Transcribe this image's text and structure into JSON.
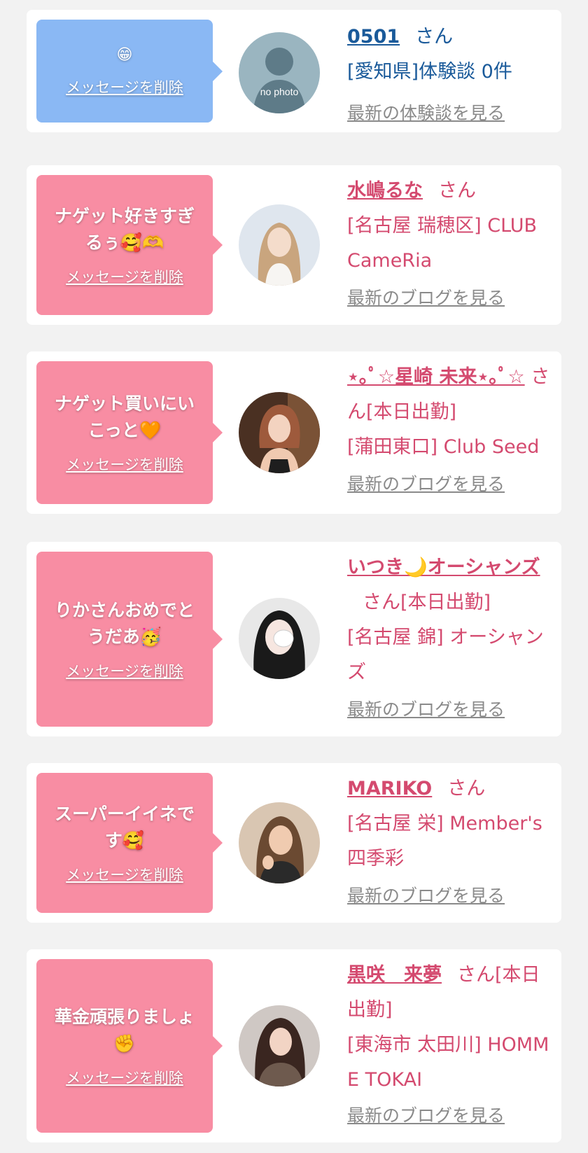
{
  "colors": {
    "page_background": "#f2f2f2",
    "card_background": "#ffffff",
    "bubble_blue": "#8ab8f4",
    "bubble_pink": "#f88da3",
    "text_pink": "#d44a6f",
    "text_blue": "#1a5a9a",
    "link_gray": "#8a8a8a"
  },
  "delete_label": "メッセージを削除",
  "cards": [
    {
      "message": "😁",
      "name": "0501",
      "san": "さん",
      "location": "[愛知県]体験談 0件",
      "view_link": "最新の体験談を見る",
      "avatar_text": "no photo",
      "avatar_icon": "no-photo-silhouette-icon"
    },
    {
      "message": "ナゲット好きすぎるぅ🥰🫶",
      "name": "水嶋るな",
      "san": "さん",
      "location": "[名古屋 瑞穂区] CLUB CameRia",
      "view_link": "最新のブログを見る"
    },
    {
      "message": "ナゲット買いにいこっと🧡",
      "name": "⋆｡ﾟ☆星崎 未来⋆｡ﾟ☆",
      "san": "さん[本日出勤]",
      "location": "[蒲田東口] Club Seed",
      "view_link": "最新のブログを見る"
    },
    {
      "message": "りかさんおめでとうだあ🥳",
      "name": "いつき🌙オーシャンズ",
      "san": "さん[本日出勤]",
      "location": "[名古屋 錦] オーシャンズ",
      "view_link": "最新のブログを見る"
    },
    {
      "message": "スーパーイイネです🥰",
      "name": "MARIKO",
      "san": "さん",
      "location": "[名古屋 栄] Member's 四季彩",
      "view_link": "最新のブログを見る"
    },
    {
      "message": "華金頑張りましょ✊",
      "name": "黒咲　来夢",
      "san": "さん[本日出勤]",
      "location": "[東海市 太田川] HOMME TOKAI",
      "view_link": "最新のブログを見る"
    }
  ]
}
